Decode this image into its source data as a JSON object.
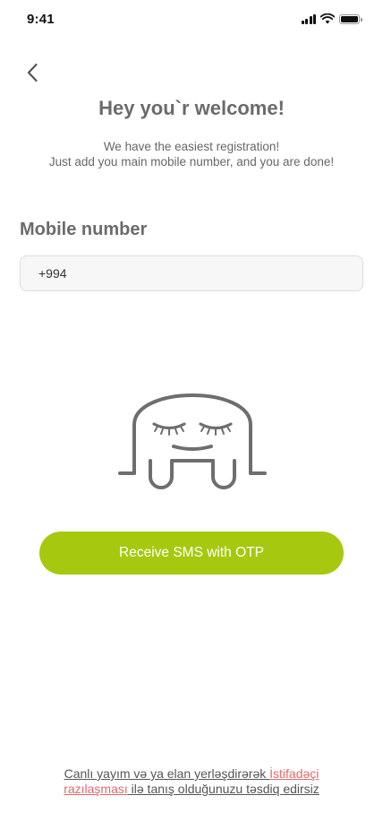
{
  "status_bar": {
    "time": "9:41"
  },
  "header": {
    "title": "Hey you`r welcome!",
    "subtitle_line1": "We have the easiest registration!",
    "subtitle_line2": "Just add you main mobile number, and you are done!"
  },
  "form": {
    "label": "Mobile number",
    "phone_value": "+994"
  },
  "actions": {
    "submit_label": "Receive SMS with OTP"
  },
  "footer": {
    "text_before": "Canlı yayım və ya elan yerləşdirərək ",
    "link_part1": "İstifadəçi",
    "link_part2": "razılaşması",
    "text_after": " ilə tanış olduğunuzu təsdiq edirsiz"
  },
  "colors": {
    "accent": "#a6c90f",
    "link": "#e06a6a",
    "heading": "#6b6b6b"
  },
  "icons": [
    "back-chevron-icon",
    "signal-icon",
    "wifi-icon",
    "battery-icon",
    "sleeping-ghost-mascot"
  ]
}
